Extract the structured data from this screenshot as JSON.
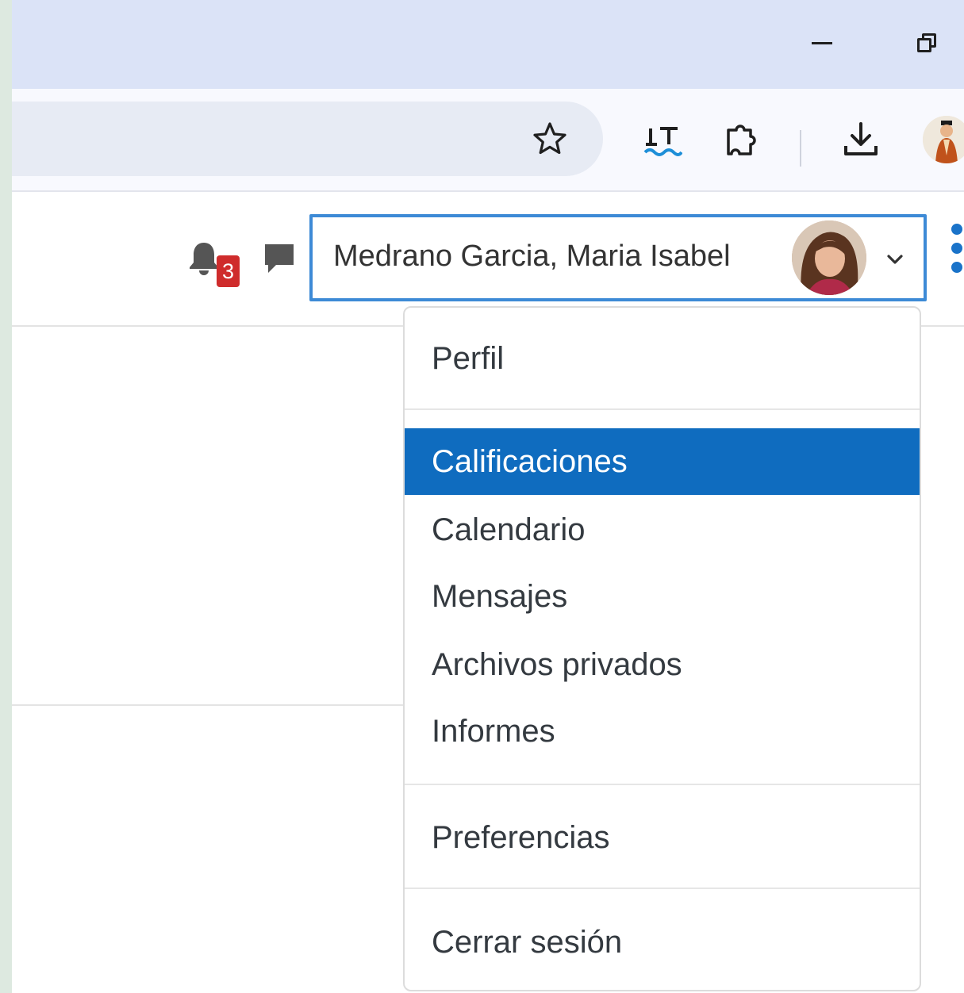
{
  "user_menu": {
    "name": "Medrano Garcia, Maria Isabel",
    "items": [
      {
        "label": "Perfil"
      },
      {
        "label": "Calificaciones",
        "active": true
      },
      {
        "label": "Calendario"
      },
      {
        "label": "Mensajes"
      },
      {
        "label": "Archivos privados"
      },
      {
        "label": "Informes"
      },
      {
        "label": "Preferencias"
      },
      {
        "label": "Cerrar sesión"
      }
    ]
  },
  "notifications": {
    "count": "3"
  },
  "icons": {
    "window": [
      "minimize-icon",
      "restore-icon"
    ],
    "toolbar": [
      "star-icon",
      "languagetool-icon",
      "extensions-puzzle-icon",
      "download-icon",
      "profile-avatar-icon"
    ],
    "header": [
      "bell-icon",
      "chat-icon",
      "chevron-down-icon",
      "kebab-menu-icon"
    ]
  },
  "colors": {
    "titlebar_bg": "#dbe3f7",
    "active_item_bg": "#0f6cbf",
    "focus_border": "#3d8ad6",
    "badge_bg": "#cf2c2c",
    "kebab_blue": "#1a73c9"
  }
}
